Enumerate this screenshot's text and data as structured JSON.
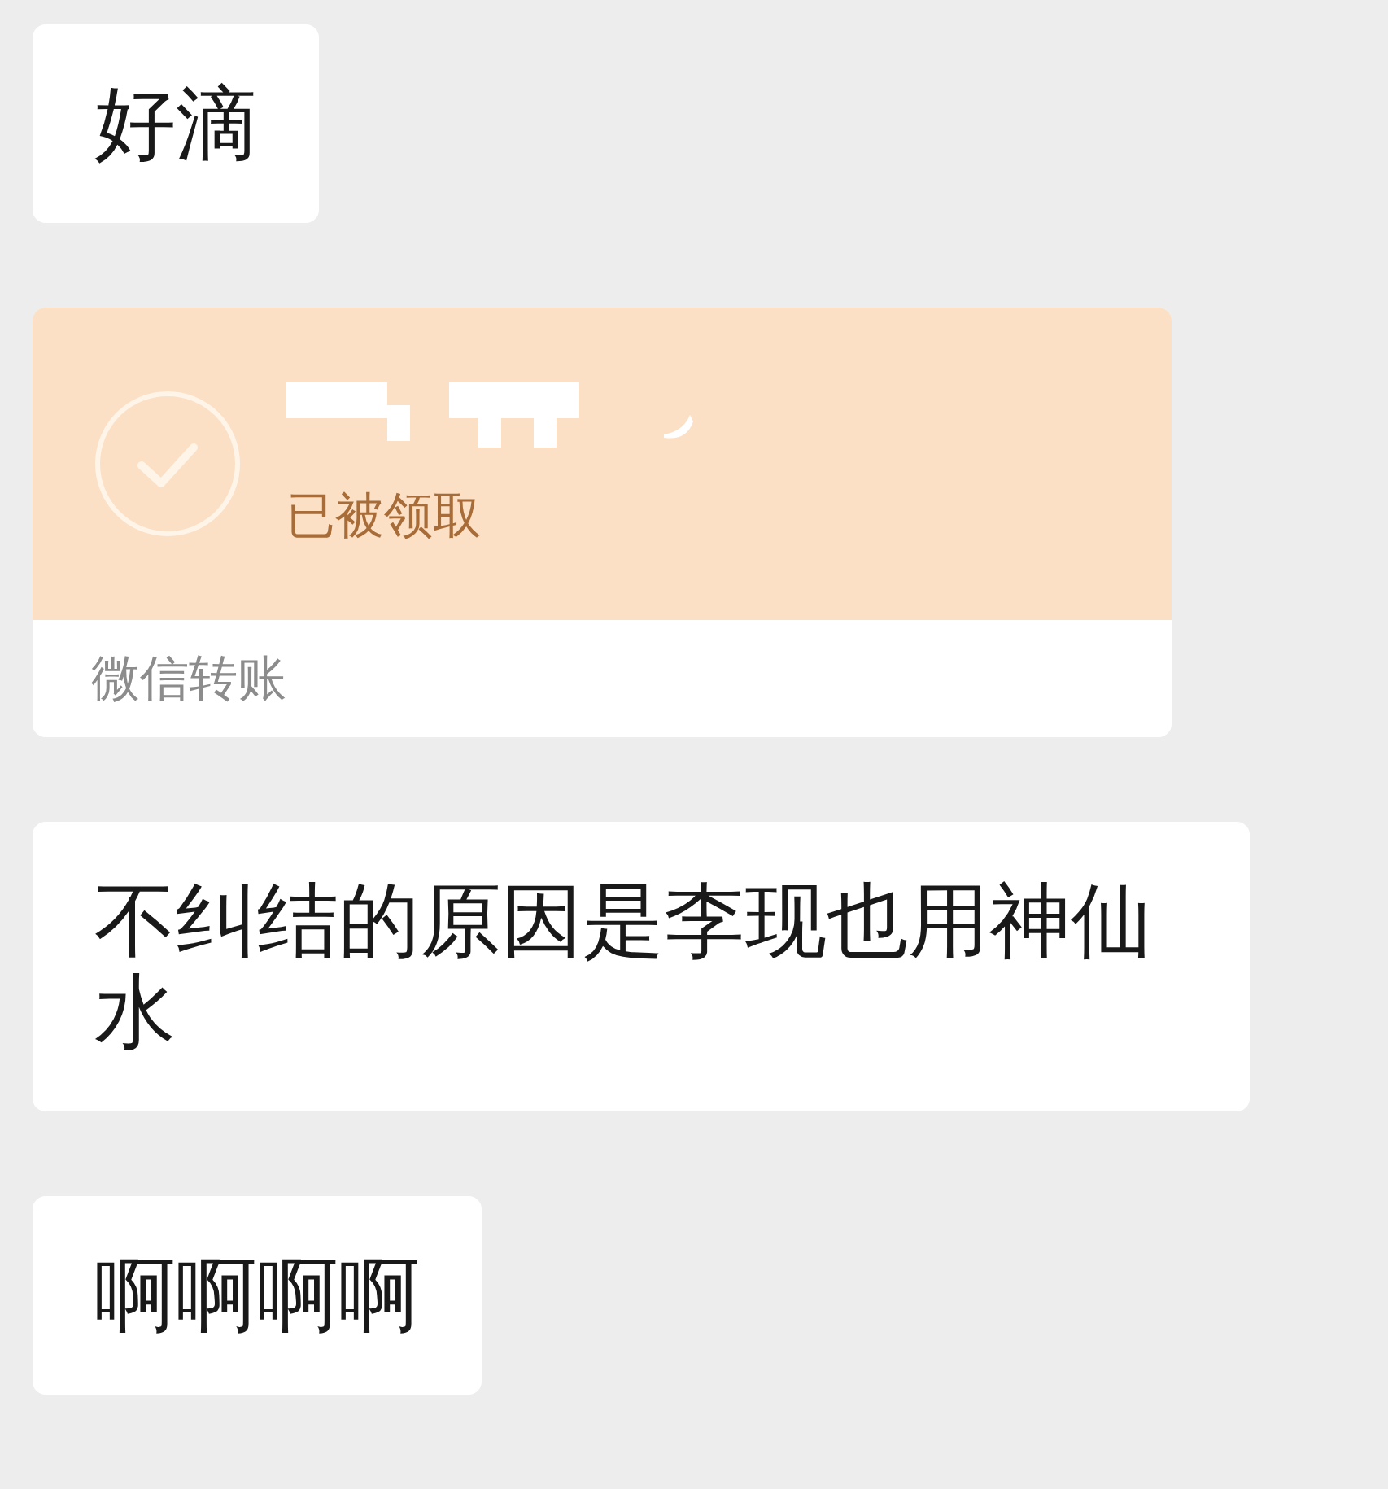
{
  "messages": [
    {
      "kind": "text",
      "text": "好滴"
    },
    {
      "kind": "transfer",
      "status": "已被领取",
      "label": "微信转账"
    },
    {
      "kind": "text",
      "text": "不纠结的原因是李现也用神仙水"
    },
    {
      "kind": "text",
      "text": "啊啊啊啊"
    }
  ]
}
